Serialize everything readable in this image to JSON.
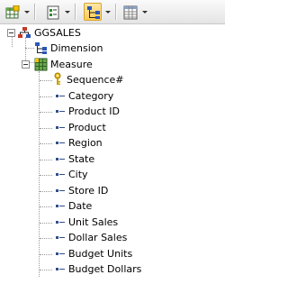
{
  "tree": {
    "root": {
      "label": "GGSALES"
    },
    "dimension": {
      "label": "Dimension"
    },
    "measure": {
      "label": "Measure"
    },
    "fields": [
      "Sequence#",
      "Category",
      "Product ID",
      "Product",
      "Region",
      "State",
      "City",
      "Store ID",
      "Date",
      "Unit Sales",
      "Dollar Sales",
      "Budget Units",
      "Budget Dollars"
    ]
  },
  "icons": {
    "table_button": "table-grid-icon",
    "view_button": "view-icon",
    "hierarchy_button": "hierarchy-icon",
    "list_button": "list-view-icon",
    "root": "database-tree-icon",
    "dimension": "dimension-hierarchy-icon",
    "measure": "measure-grid-icon",
    "key_field": "key-icon",
    "field": "column-icon"
  },
  "colors": {
    "pressed_button": "#ffcc55",
    "field_icon": "#2f4e8a"
  }
}
